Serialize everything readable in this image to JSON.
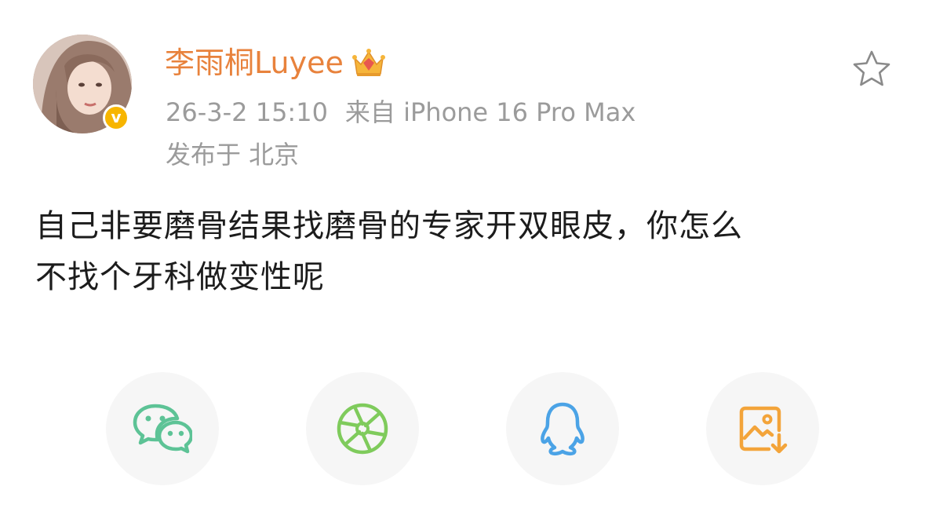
{
  "user": {
    "name": "李雨桐Luyee",
    "verified_mark": "v",
    "avatar_icon": "user-avatar",
    "crown_icon": "crown-icon"
  },
  "post": {
    "time": "26-3-2 15:10",
    "source": "来自 iPhone 16 Pro Max",
    "location": "发布于 北京",
    "text_line1": "自己非要磨骨结果找磨骨的专家开双眼皮，你怎么",
    "text_line2": "不找个牙科做变性呢"
  },
  "actions": {
    "favorite_icon": "star-icon"
  },
  "share": {
    "items": [
      {
        "name": "wechat",
        "icon": "wechat-icon",
        "color": "#5dc396"
      },
      {
        "name": "moments",
        "icon": "moments-icon",
        "color": "#7fcb5c"
      },
      {
        "name": "qq",
        "icon": "qq-icon",
        "color": "#4ba3e6"
      },
      {
        "name": "save-image",
        "icon": "save-image-icon",
        "color": "#f3a43a"
      }
    ]
  },
  "colors": {
    "username": "#e8823c",
    "meta": "#9b9b9b",
    "body_text": "#1c1c1c",
    "verified": "#f7b500",
    "button_bg": "#f6f6f6"
  }
}
